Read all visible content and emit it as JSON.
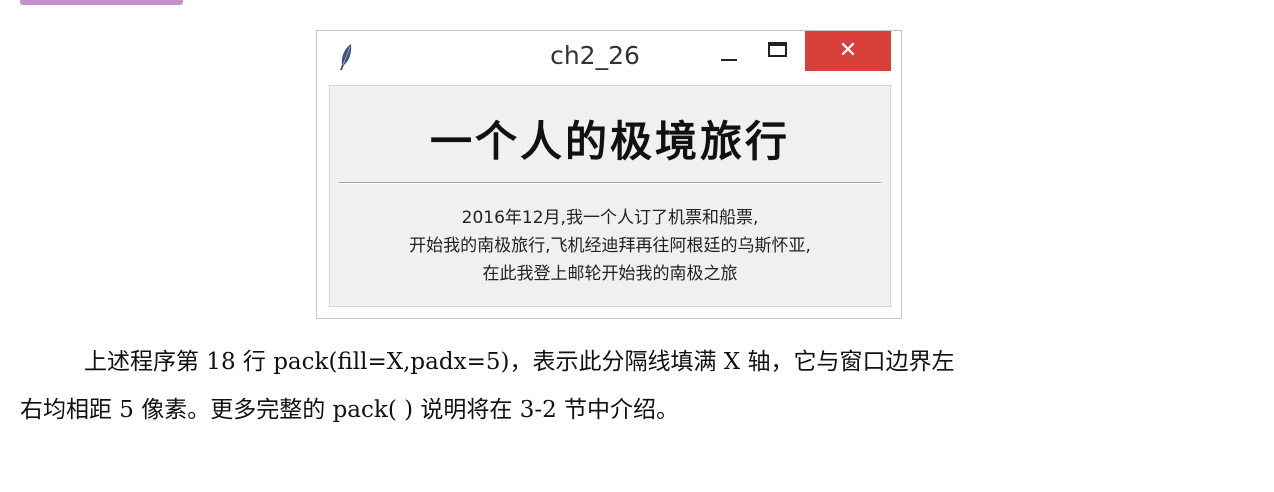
{
  "window": {
    "title": "ch2_26",
    "close_label": "✕",
    "close_color": "#d9403a",
    "app_icon": "feather-icon"
  },
  "content": {
    "heading": "一个人的极境旅行",
    "lines": [
      "2016年12月,我一个人订了机票和船票,",
      "开始我的南极旅行,飞机经迪拜再往阿根廷的乌斯怀亚,",
      "在此我登上邮轮开始我的南极之旅"
    ]
  },
  "paragraph": {
    "line1": "上述程序第 18 行 pack(fill=X,padx=5)，表示此分隔线填满 X 轴，它与窗口边界左",
    "line2": "右均相距 5 像素。更多完整的 pack( ) 说明将在 3-2 节中介绍。"
  }
}
